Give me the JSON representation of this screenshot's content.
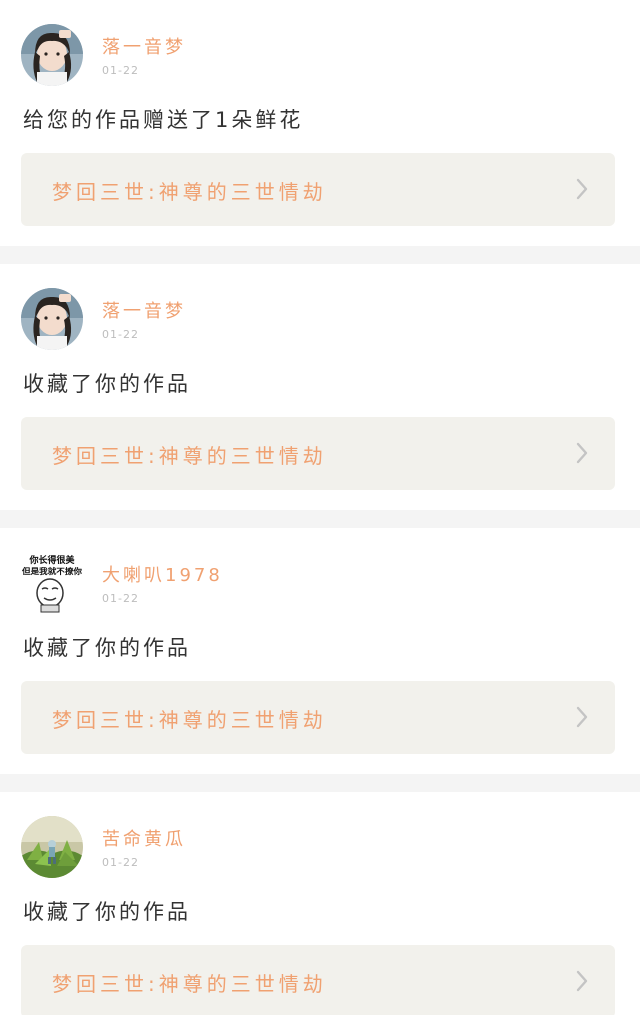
{
  "feed": {
    "items": [
      {
        "user_name": "落一音梦",
        "date": "01-22",
        "action": "给您的作品赠送了1朵鲜花",
        "work_title": "梦回三世:神尊的三世情劫",
        "avatar_icon": "girl-portrait-avatar"
      },
      {
        "user_name": "落一音梦",
        "date": "01-22",
        "action": "收藏了你的作品",
        "work_title": "梦回三世:神尊的三世情劫",
        "avatar_icon": "girl-portrait-avatar"
      },
      {
        "user_name": "大喇叭1978",
        "date": "01-22",
        "action": "收藏了你的作品",
        "work_title": "梦回三世:神尊的三世情劫",
        "avatar_icon": "meme-face-avatar",
        "avatar_caption_line1": "你长得很美",
        "avatar_caption_line2": "但是我就不撩你"
      },
      {
        "user_name": "苦命黄瓜",
        "date": "01-22",
        "action": "收藏了你的作品",
        "work_title": "梦回三世:神尊的三世情劫",
        "avatar_icon": "plant-figurine-avatar"
      }
    ]
  },
  "colors": {
    "accent": "#f0a171",
    "text": "#333333",
    "muted": "#bdbdbd",
    "link_bg": "#f2f1ec",
    "divider": "#f4f4f4"
  }
}
